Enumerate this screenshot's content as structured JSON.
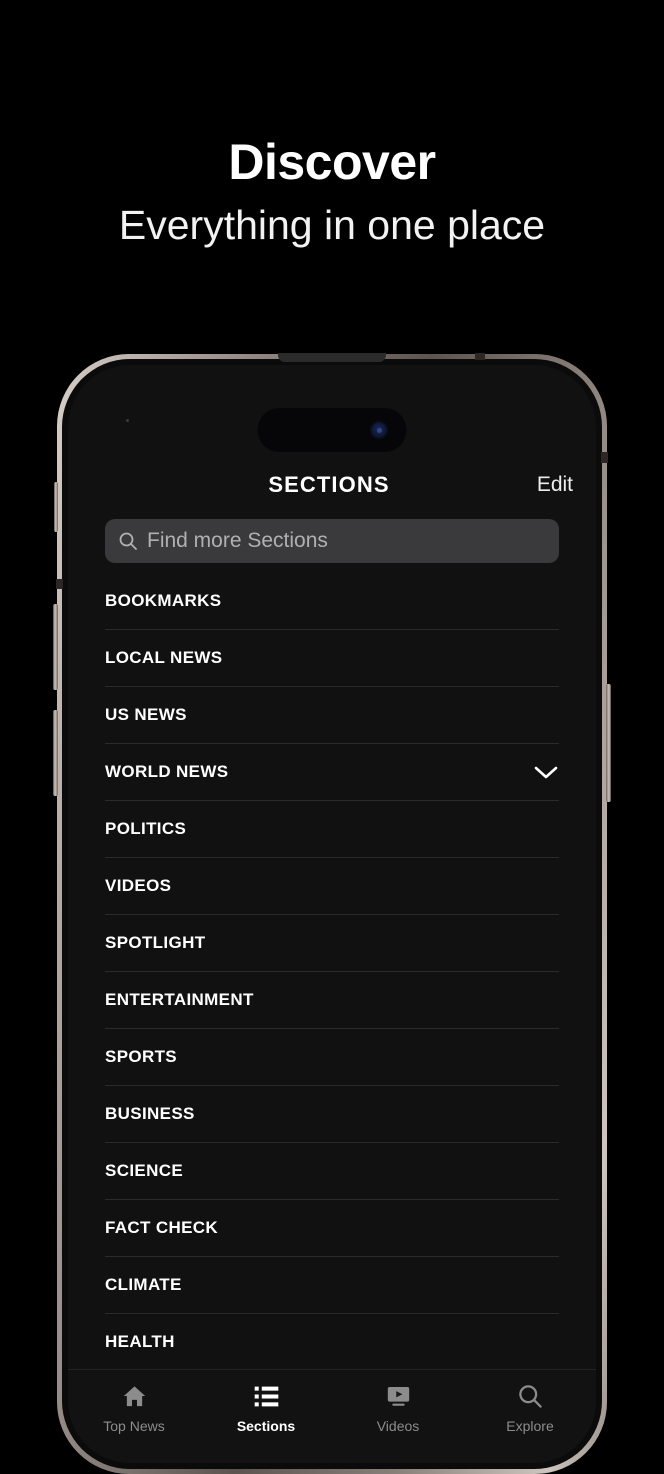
{
  "promo": {
    "title": "Discover",
    "subtitle": "Everything in one place"
  },
  "colors": {
    "screen_bg": "#111112",
    "search_bg": "#3a3a3c",
    "divider": "#2a2a2b",
    "text_primary": "#ffffff",
    "text_muted": "#8c8c8c",
    "tabbar_bg": "#121213"
  },
  "app": {
    "header": {
      "title": "SECTIONS",
      "edit_label": "Edit"
    },
    "search": {
      "icon": "search-icon",
      "placeholder": "Find more Sections",
      "value": ""
    },
    "sections": [
      {
        "label": "BOOKMARKS",
        "chevron": false
      },
      {
        "label": "LOCAL NEWS",
        "chevron": false
      },
      {
        "label": "US NEWS",
        "chevron": false
      },
      {
        "label": "WORLD NEWS",
        "chevron": true
      },
      {
        "label": "POLITICS",
        "chevron": false
      },
      {
        "label": "VIDEOS",
        "chevron": false
      },
      {
        "label": "SPOTLIGHT",
        "chevron": false
      },
      {
        "label": "ENTERTAINMENT",
        "chevron": false
      },
      {
        "label": "SPORTS",
        "chevron": false
      },
      {
        "label": "BUSINESS",
        "chevron": false
      },
      {
        "label": "SCIENCE",
        "chevron": false
      },
      {
        "label": "FACT CHECK",
        "chevron": false
      },
      {
        "label": "CLIMATE",
        "chevron": false
      },
      {
        "label": "HEALTH",
        "chevron": false
      }
    ],
    "tabs": [
      {
        "label": "Top News",
        "icon": "home-icon",
        "active": false
      },
      {
        "label": "Sections",
        "icon": "list-icon",
        "active": true
      },
      {
        "label": "Videos",
        "icon": "video-icon",
        "active": false
      },
      {
        "label": "Explore",
        "icon": "search-icon",
        "active": false
      }
    ]
  }
}
